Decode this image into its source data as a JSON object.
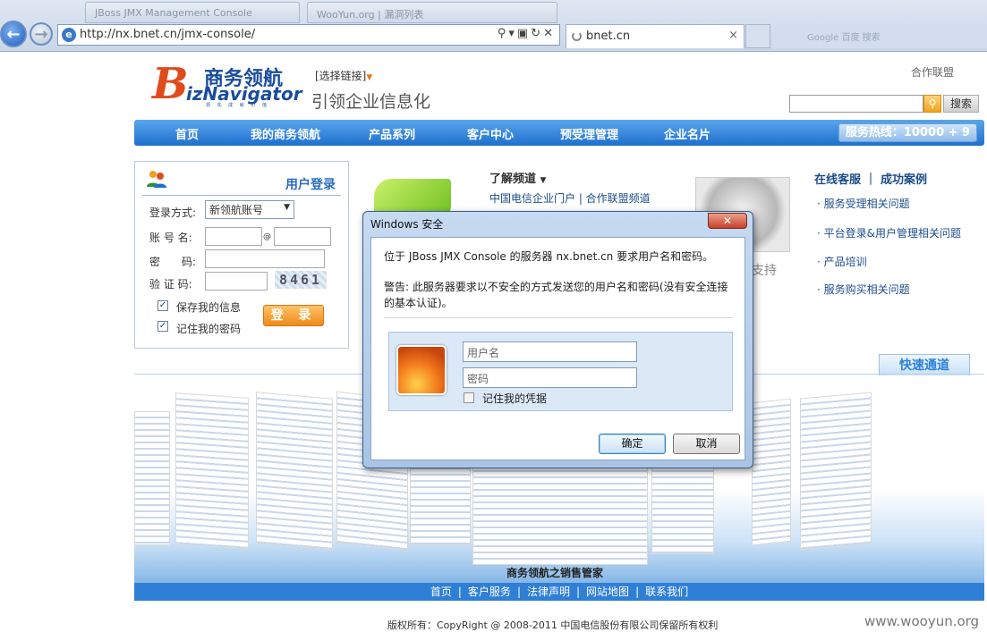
{
  "browser": {
    "background_tabs": [
      "JBoss JMX Management Console",
      "WooYun.org | 漏洞列表"
    ],
    "address_url": "http://nx.bnet.cn/jmx-console/",
    "active_tab_title": "bnet.cn",
    "active_tab_close": "×",
    "right_search_hint": "Google 百度 搜索"
  },
  "header": {
    "logo_cn": "商务领航",
    "logo_letter": "B",
    "logo_en": "izNavigator",
    "logo_small": "领 先 成 就 价 值",
    "select_link": "[选择链接]",
    "slogan": "引领企业信息化",
    "top_link": "合作联盟",
    "search_button": "搜索"
  },
  "nav": {
    "items": [
      "首页",
      "我的商务领航",
      "产品系列",
      "客户中心",
      "预受理管理",
      "企业名片"
    ],
    "hotline": "服务热线：10000 + 9"
  },
  "login": {
    "title": "用户登录",
    "method_label": "登录方式:",
    "method_value": "新领航账号",
    "account_label": "账 号 名:",
    "at_sign": "@",
    "password_label": "密　　码:",
    "captcha_label": "验 证 码:",
    "captcha_value": "8461",
    "save_info": "保存我的信息",
    "remember_password": "记住我的密码",
    "login_button": "登 录"
  },
  "content": {
    "understand_title": "了解频道",
    "understand_links": "中国电信企业门户 | 合作联盟频道",
    "support_text": "支持",
    "right_head": "在线客服 ｜ 成功案例",
    "right_links": [
      "服务受理相关问题",
      "平台登录&用户管理相关问题",
      "产品培训",
      "服务购买相关问题"
    ],
    "quick_channel": "快速通道"
  },
  "banner": {
    "caption": "商务领航之销售管家"
  },
  "footer": {
    "links": [
      "首页",
      "客户服务",
      "法律声明",
      "网站地图",
      "联系我们"
    ],
    "copyright": "版权所有：CopyRight @ 2008-2011 中国电信股份有限公司保留所有权利",
    "watermark": "www.wooyun.org"
  },
  "dialog": {
    "title": "Windows 安全",
    "message": "位于 JBoss JMX Console 的服务器 nx.bnet.cn 要求用户名和密码。",
    "warning": "警告: 此服务器要求以不安全的方式发送您的用户名和密码(没有安全连接的基本认证)。",
    "username_placeholder": "用户名",
    "password_placeholder": "密码",
    "remember_label": "记住我的凭据",
    "ok_button": "确定",
    "cancel_button": "取消"
  },
  "colors": {
    "nav_blue": "#1e6fcd",
    "login_orange": "#f08a1a",
    "logo_red": "#e14b1c",
    "logo_blue": "#1a4c9c"
  }
}
